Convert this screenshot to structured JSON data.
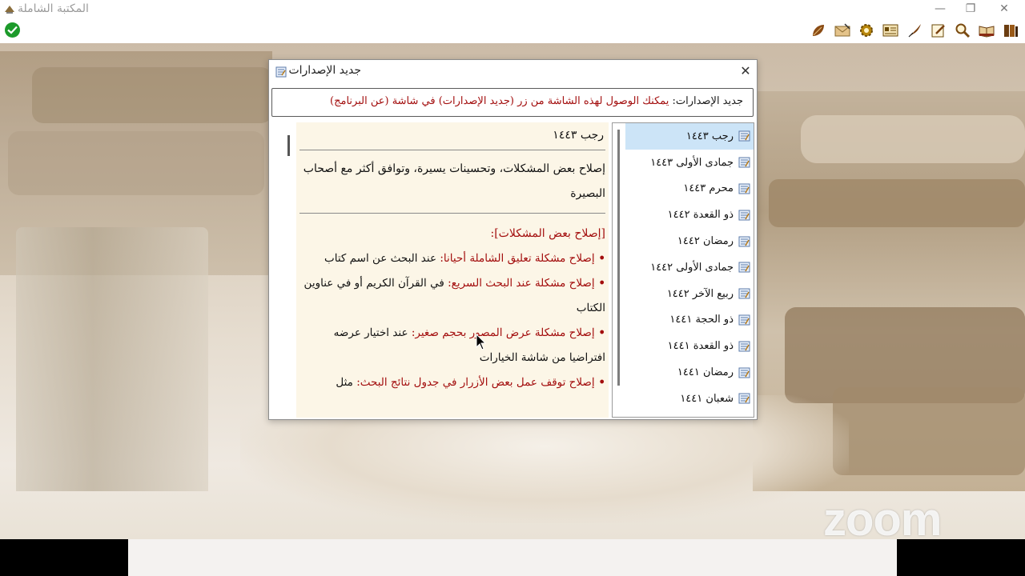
{
  "window": {
    "title": "المكتبة الشاملة",
    "minimize_label": "—",
    "restore_label": "❐",
    "close_label": "✕"
  },
  "toolbar": {
    "icons": [
      "leaf-icon",
      "envelope-icon",
      "settings-gear-icon",
      "panel-icon",
      "quill-icon",
      "edit-icon",
      "search-icon",
      "open-book-icon",
      "books-icon"
    ]
  },
  "dialog": {
    "title": "جديد الإصدارات",
    "close_label": "✕",
    "notice_label": "جديد الإصدارات:",
    "notice_text": "يمكنك الوصول لهذه الشاشة من زر (جديد الإصدارات) في شاشة (عن البرنامج)",
    "versions": [
      {
        "label": "رجب ١٤٤٣",
        "selected": true
      },
      {
        "label": "جمادى الأولى ١٤٤٣",
        "selected": false
      },
      {
        "label": "محرم ١٤٤٣",
        "selected": false
      },
      {
        "label": "ذو القعدة ١٤٤٢",
        "selected": false
      },
      {
        "label": "رمضان ١٤٤٢",
        "selected": false
      },
      {
        "label": "جمادى الأولى ١٤٤٢",
        "selected": false
      },
      {
        "label": "ربيع الآخر ١٤٤٢",
        "selected": false
      },
      {
        "label": "ذو الحجة ١٤٤١",
        "selected": false
      },
      {
        "label": "ذو القعدة ١٤٤١",
        "selected": false
      },
      {
        "label": "رمضان ١٤٤١",
        "selected": false
      },
      {
        "label": "شعبان ١٤٤١",
        "selected": false
      }
    ],
    "content": {
      "heading": "رجب ١٤٤٣",
      "intro": "إصلاح بعض المشكلات، وتحسينات يسيرة، وتوافق أكثر مع أصحاب البصيرة",
      "section": "[إصلاح بعض المشكلات]:",
      "items": [
        {
          "title": "إصلاح مشكلة تعليق الشاملة أحيانا:",
          "desc": "عند البحث عن اسم كتاب"
        },
        {
          "title": "إصلاح مشكلة عند البحث السريع:",
          "desc": "في القرآن الكريم أو في عناوين الكتاب"
        },
        {
          "title": "إصلاح مشكلة عرض المصور بحجم صغير:",
          "desc": "عند اختيار عرضه افتراضيا من شاشة الخيارات"
        },
        {
          "title": "إصلاح توقف عمل بعض الأزرار في جدول نتائج البحث:",
          "desc": "مثل"
        }
      ]
    }
  },
  "watermark": "zoom",
  "colors": {
    "accent_red": "#a30e0e",
    "selection": "#cce4f7",
    "content_bg": "#fcf6e7",
    "ok_green": "#1c9a2a"
  }
}
